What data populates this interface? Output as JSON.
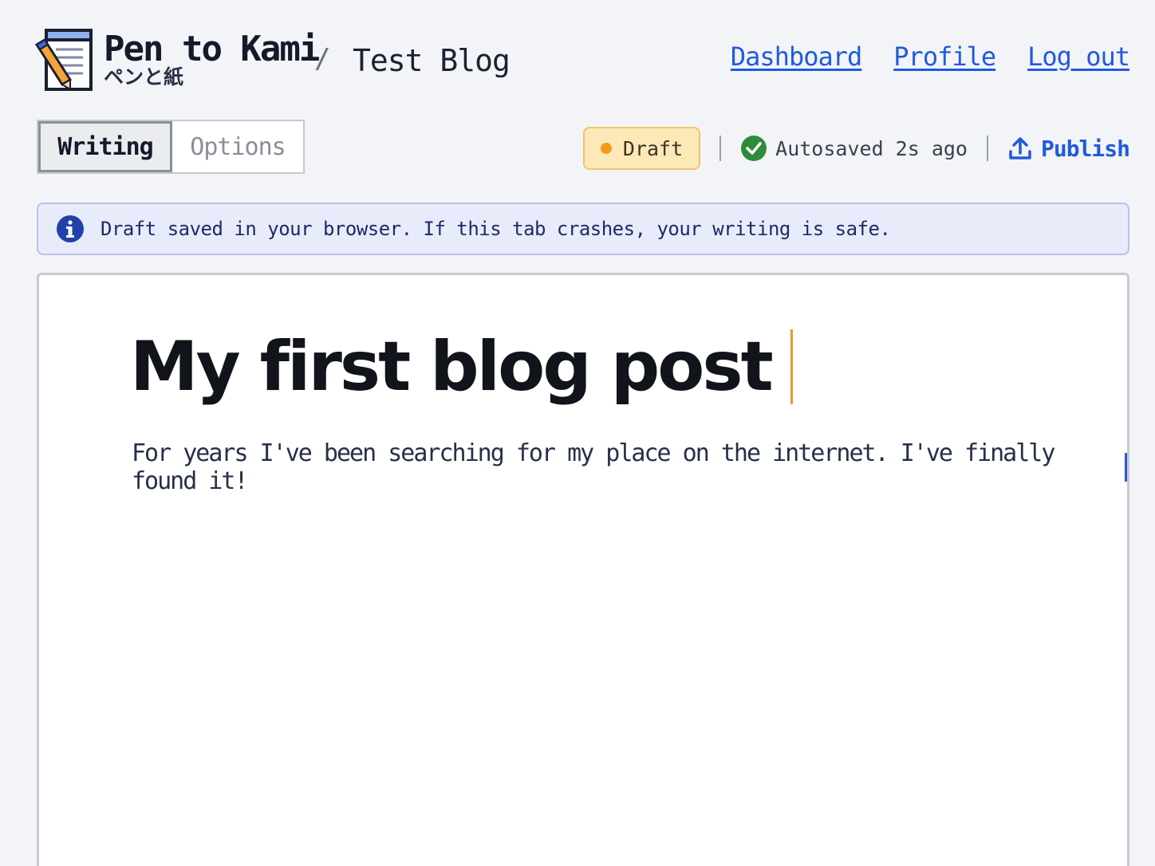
{
  "header": {
    "brand_name": "Pen to Kami",
    "brand_sub": "ペンと紙",
    "separator": "/",
    "blog_name": "Test Blog",
    "nav": [
      "Dashboard",
      "Profile",
      "Log out"
    ]
  },
  "toolbar": {
    "tabs": [
      "Writing",
      "Options"
    ],
    "active_tab": "Writing",
    "status_badge": "Draft",
    "autosave_text": "Autosaved 2s ago",
    "publish_label": "Publish"
  },
  "banner": {
    "text": "Draft saved in your browser. If this tab crashes, your writing is safe."
  },
  "editor": {
    "title": "My first blog post",
    "body": "For years I've been searching for my place on the internet. I've finally found it!"
  },
  "colors": {
    "accent": "#1f5bdc",
    "draft_badge_bg": "#fde9b8",
    "draft_dot": "#f59a1b",
    "success": "#2e8b3c",
    "banner_bg": "#e8ecfa"
  },
  "icons": {
    "logo": "notepad-pencil-icon",
    "autosave": "check-circle-icon",
    "publish": "upload-icon",
    "banner": "info-icon"
  }
}
